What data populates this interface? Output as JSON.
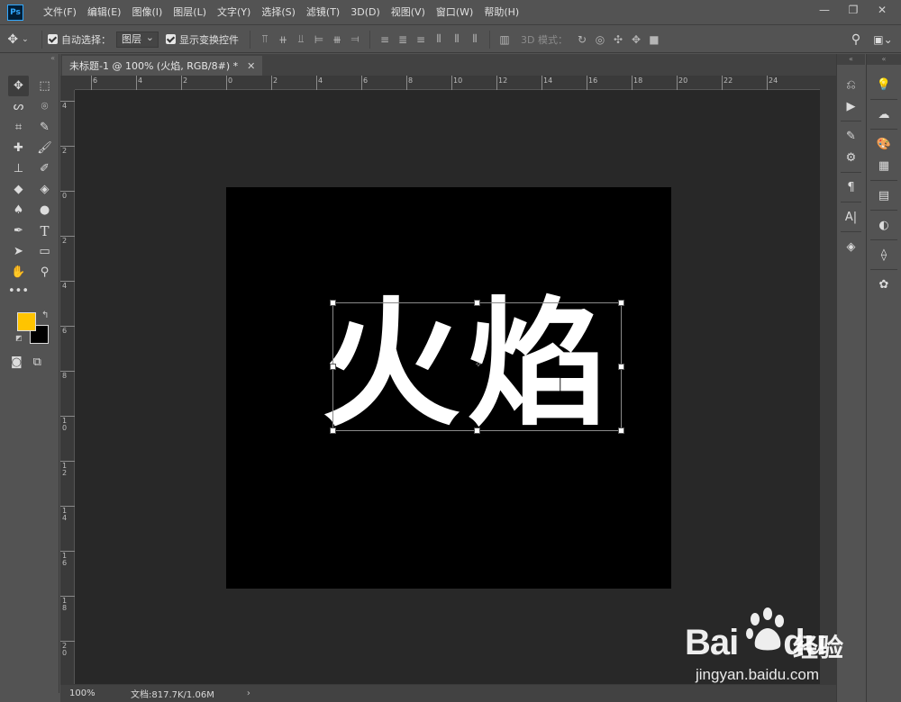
{
  "app": {
    "logo_text": "Ps"
  },
  "menu": [
    "文件(F)",
    "编辑(E)",
    "图像(I)",
    "图层(L)",
    "文字(Y)",
    "选择(S)",
    "滤镜(T)",
    "3D(D)",
    "视图(V)",
    "窗口(W)",
    "帮助(H)"
  ],
  "window_controls": {
    "minimize": "—",
    "restore": "❐",
    "close": "✕"
  },
  "options_bar": {
    "auto_select_label": "自动选择：",
    "auto_select_value": "图层",
    "show_transform_label": "显示变换控件",
    "mode_3d_label": "3D 模式："
  },
  "document": {
    "tab_title": "未标题-1 @ 100% (火焰, RGB/8#) *",
    "canvas_text": "火焰",
    "foreground_color": "#ffc400",
    "background_color": "#000000"
  },
  "ruler_h": [
    "6",
    "4",
    "2",
    "0",
    "2",
    "4",
    "6",
    "8",
    "10",
    "12",
    "14",
    "16",
    "18",
    "20",
    "22",
    "24"
  ],
  "ruler_v": [
    "4",
    "2",
    "0",
    "2",
    "4",
    "6",
    "8",
    "1\n0",
    "1\n2",
    "1\n4",
    "1\n6",
    "1\n8",
    "2\n0"
  ],
  "status": {
    "zoom": "100%",
    "doc_info": "文档:817.7K/1.06M",
    "arrow": "›"
  },
  "watermark": {
    "logo": "Bai",
    "logo_tail": "du",
    "chinese": "经验",
    "url": "jingyan.baidu.com"
  }
}
